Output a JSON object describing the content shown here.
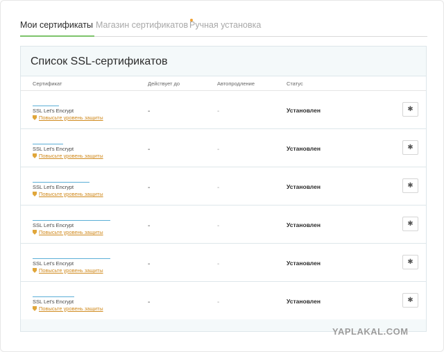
{
  "tabs": [
    {
      "label": "Мои сертификаты",
      "active": true
    },
    {
      "label": "Магазин сертификатов",
      "active": false,
      "badge_dot": true
    },
    {
      "label": "Ручная установка",
      "active": false
    }
  ],
  "panel": {
    "title": "Список SSL-сертификатов",
    "columns": [
      "Сертификат",
      "Действует до",
      "Автопродление",
      "Статус"
    ]
  },
  "rows": [
    {
      "host": "",
      "type": "SSL Let's Encrypt",
      "upgrade": "Повысьте уровень защиты",
      "valid_until": "-",
      "autorenew": "-",
      "status": "Установлен",
      "settings_icon": "gear-icon"
    },
    {
      "host": "",
      "type": "SSL Let's Encrypt",
      "upgrade": "Повысьте уровень защиты",
      "valid_until": "-",
      "autorenew": "-",
      "status": "Установлен",
      "settings_icon": "gear-icon"
    },
    {
      "host": "",
      "type": "SSL Let's Encrypt",
      "upgrade": "Повысьте уровень защиты",
      "valid_until": "-",
      "autorenew": "-",
      "status": "Установлен",
      "settings_icon": "gear-icon"
    },
    {
      "host": "",
      "type": "SSL Let's Encrypt",
      "upgrade": "Повысьте уровень защиты",
      "valid_until": "-",
      "autorenew": "-",
      "status": "Установлен",
      "settings_icon": "gear-icon"
    },
    {
      "host": "",
      "type": "SSL Let's Encrypt",
      "upgrade": "Повысьте уровень защиты",
      "valid_until": "-",
      "autorenew": "-",
      "status": "Установлен",
      "settings_icon": "gear-icon"
    },
    {
      "host": "",
      "type": "SSL Let's Encrypt",
      "upgrade": "Повысьте уровень защиты",
      "valid_until": "-",
      "autorenew": "-",
      "status": "Установлен",
      "settings_icon": "gear-icon"
    }
  ],
  "watermark": "YAPLAKAL.COM",
  "colors": {
    "accent_underline": "#7cc36a",
    "badge_dot": "#f0a030",
    "upgrade_link": "#d08a1e",
    "panel_header_bg": "#f4f9fa"
  }
}
